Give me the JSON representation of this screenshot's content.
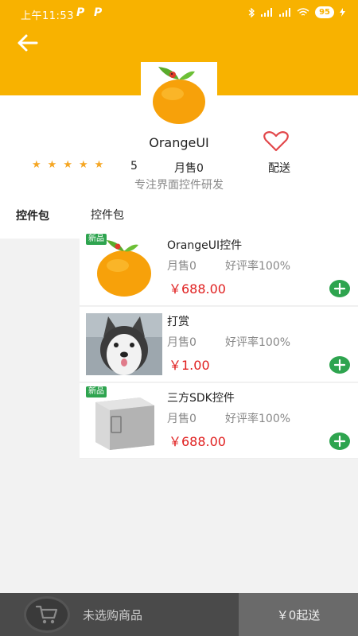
{
  "status_bar": {
    "time": "上午11:53",
    "battery": "95"
  },
  "shop": {
    "name": "OrangeUI",
    "stars": [
      "★",
      "★",
      "★",
      "★",
      "★"
    ],
    "rating": "5",
    "monthly_sales": "月售0",
    "delivery": "配送",
    "slogan": "专注界面控件研发"
  },
  "sidebar": {
    "items": [
      {
        "label": "控件包"
      }
    ]
  },
  "main": {
    "section_title": "控件包",
    "products": [
      {
        "name": "OrangeUI控件",
        "sales": "月售0",
        "rate": "好评率100%",
        "price": "￥688.00",
        "badge": "新品",
        "image": "orange-logo"
      },
      {
        "name": "打赏",
        "sales": "月售0",
        "rate": "好评率100%",
        "price": "￥1.00",
        "badge": "",
        "image": "husky-photo"
      },
      {
        "name": "三方SDK控件",
        "sales": "月售0",
        "rate": "好评率100%",
        "price": "￥688.00",
        "badge": "新品",
        "image": "sdk-box"
      }
    ]
  },
  "bottom_bar": {
    "cart_text": "未选购商品",
    "checkout_label": "￥0起送"
  },
  "colors": {
    "brand": "#f8b200",
    "price": "#e02020",
    "add": "#2ea44f",
    "badge": "#2ea44f"
  }
}
